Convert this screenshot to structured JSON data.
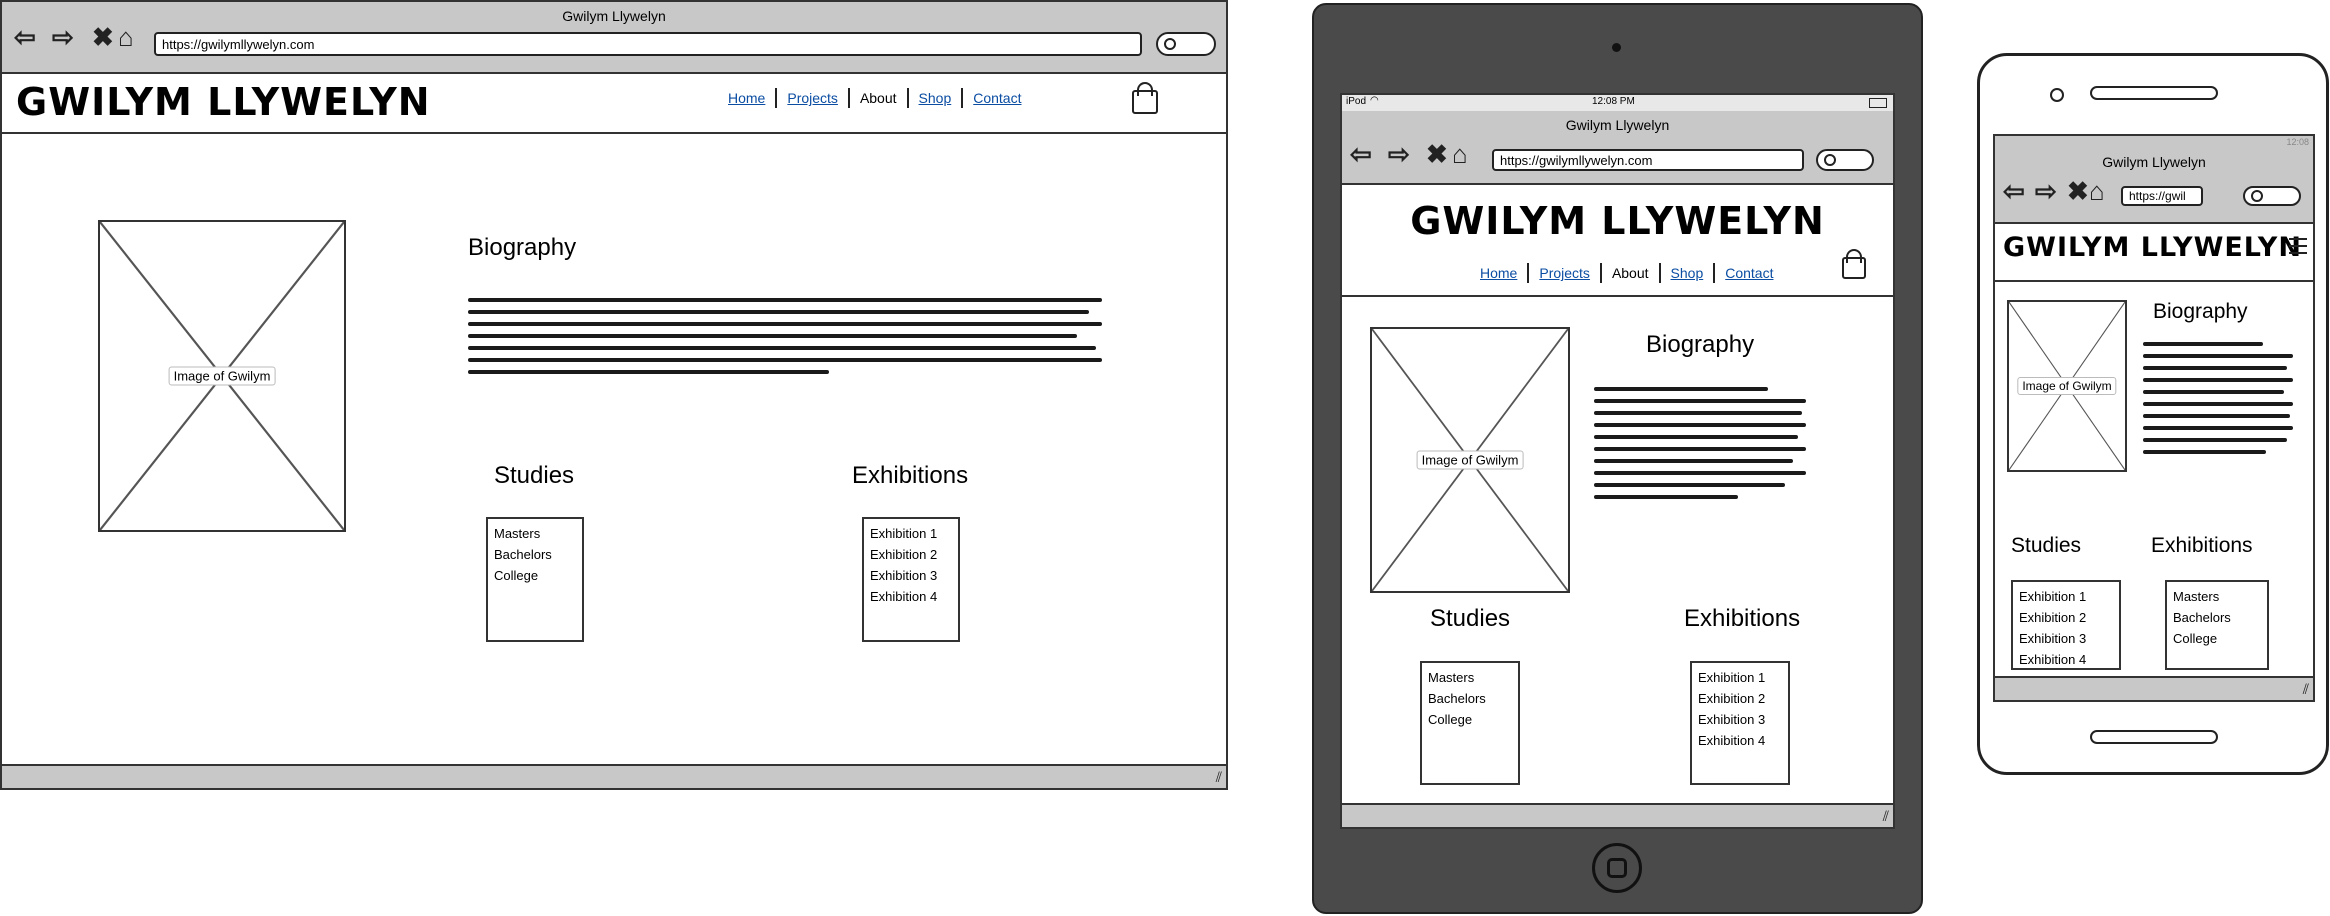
{
  "window_title": "Gwilym Llywelyn",
  "url": "https://gwilymllywelyn.com",
  "url_phone": "https://gwil",
  "brand": "GWILYM LLYWELYN",
  "nav": {
    "home": "Home",
    "projects": "Projects",
    "about": "About",
    "shop": "Shop",
    "contact": "Contact"
  },
  "image_caption": "Image of Gwilym",
  "biography_heading": "Biography",
  "studies_heading": "Studies",
  "exhibitions_heading": "Exhibitions",
  "studies": [
    "Masters",
    "Bachelors",
    "College"
  ],
  "exhibitions": [
    "Exhibition 1",
    "Exhibition 2",
    "Exhibition 3",
    "Exhibition 4"
  ],
  "tablet_status": {
    "carrier": "iPod",
    "time": "12:08 PM"
  },
  "phone_status": {
    "time": "12:08"
  }
}
